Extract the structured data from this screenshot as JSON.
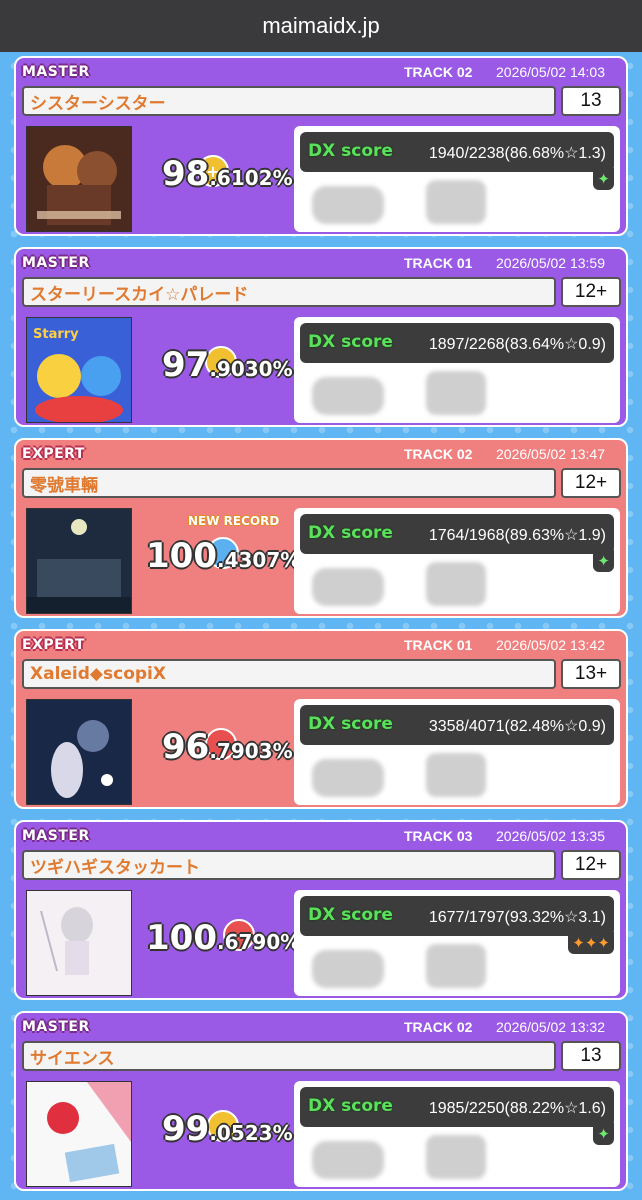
{
  "browser": {
    "url": "maimaidx.jp"
  },
  "records": [
    {
      "difficulty": "MASTER",
      "track": "TRACK 02",
      "date": "2026/05/02 14:03",
      "title": "シスターシスター",
      "level": "13",
      "achievement_int": "98",
      "achievement_dec": ".6102%",
      "new_record": "",
      "dx_label": "DX score",
      "dx_score": "1940/2238(86.68%☆1.3)",
      "stars": "✦",
      "star_color": "green",
      "jacket": "sister-sister-jacket"
    },
    {
      "difficulty": "MASTER",
      "track": "TRACK 01",
      "date": "2026/05/02 13:59",
      "title": "スターリースカイ☆パレード",
      "level": "12+",
      "achievement_int": "97",
      "achievement_dec": ".9030%",
      "new_record": "",
      "dx_label": "DX score",
      "dx_score": "1897/2268(83.64%☆0.9)",
      "stars": "",
      "star_color": "green",
      "jacket": "starry-sky-parade-jacket"
    },
    {
      "difficulty": "EXPERT",
      "track": "TRACK 02",
      "date": "2026/05/02 13:47",
      "title": "零號車輛",
      "level": "12+",
      "achievement_int": "100",
      "achievement_dec": ".4307%",
      "new_record": "NEW RECORD",
      "dx_label": "DX score",
      "dx_score": "1764/1968(89.63%☆1.9)",
      "stars": "✦",
      "star_color": "green",
      "jacket": "night-train-jacket"
    },
    {
      "difficulty": "EXPERT",
      "track": "TRACK 01",
      "date": "2026/05/02 13:42",
      "title": "Xaleid◆scopiX",
      "level": "13+",
      "achievement_int": "96",
      "achievement_dec": ".7903%",
      "new_record": "",
      "dx_label": "DX score",
      "dx_score": "3358/4071(82.48%☆0.9)",
      "stars": "",
      "star_color": "green",
      "jacket": "xaleidscopix-jacket"
    },
    {
      "difficulty": "MASTER",
      "track": "TRACK 03",
      "date": "2026/05/02 13:35",
      "title": "ツギハギスタッカート",
      "level": "12+",
      "achievement_int": "100",
      "achievement_dec": ".6790%",
      "new_record": "",
      "dx_label": "DX score",
      "dx_score": "1677/1797(93.32%☆3.1)",
      "stars": "✦✦✦",
      "star_color": "orange",
      "jacket": "tsugihagi-staccato-jacket"
    },
    {
      "difficulty": "MASTER",
      "track": "TRACK 02",
      "date": "2026/05/02 13:32",
      "title": "サイエンス",
      "level": "13",
      "achievement_int": "99",
      "achievement_dec": ".0523%",
      "new_record": "",
      "dx_label": "DX score",
      "dx_score": "1985/2250(88.22%☆1.6)",
      "stars": "✦",
      "star_color": "green",
      "jacket": "science-jacket"
    }
  ],
  "colors": {
    "master": "#9a5ae6",
    "expert": "#f08080",
    "background": "#5fb6f2",
    "dx_green": "#5be05b"
  }
}
